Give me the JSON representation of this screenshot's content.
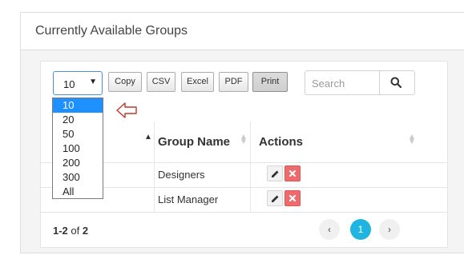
{
  "panel": {
    "title": "Currently Available Groups"
  },
  "toolbar": {
    "length_value": "10",
    "buttons": [
      "Copy",
      "CSV",
      "Excel",
      "PDF",
      "Print"
    ],
    "search_placeholder": "Search"
  },
  "table": {
    "columns": [
      "Group Name",
      "Actions"
    ],
    "rows": [
      {
        "group_name": "Designers"
      },
      {
        "group_name": "List Manager"
      }
    ]
  },
  "footer": {
    "info_range": "1-2",
    "info_of": "of",
    "info_total": "2",
    "pages": [
      "1"
    ],
    "current_page": "1"
  },
  "length_dropdown": {
    "options": [
      "10",
      "20",
      "50",
      "100",
      "200",
      "300",
      "All"
    ],
    "selected": "10"
  },
  "colors": {
    "accent": "#1fb5e0",
    "delete": "#ef6a6a",
    "select_highlight": "#1e90ff",
    "annotation_arrow": "#c0392b"
  }
}
